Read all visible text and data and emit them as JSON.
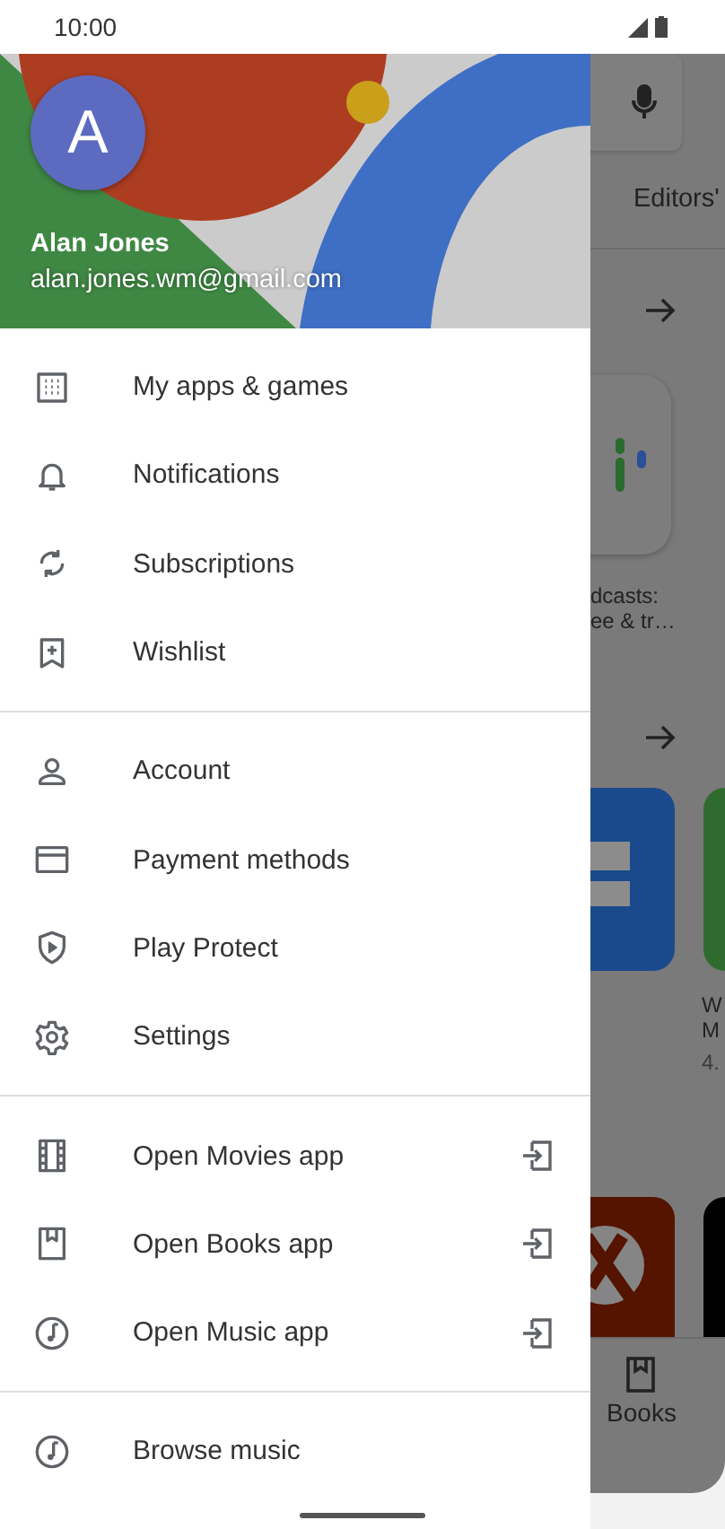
{
  "status_bar": {
    "time": "10:00"
  },
  "account": {
    "initial": "A",
    "name": "Alan Jones",
    "email": "alan.jones.wm@gmail.com"
  },
  "menu_sections": [
    {
      "items": [
        {
          "label": "My apps & games",
          "kind": "nav"
        },
        {
          "label": "Notifications",
          "kind": "nav"
        },
        {
          "label": "Subscriptions",
          "kind": "nav"
        },
        {
          "label": "Wishlist",
          "kind": "nav"
        }
      ]
    },
    {
      "items": [
        {
          "label": "Account",
          "kind": "nav"
        },
        {
          "label": "Payment methods",
          "kind": "nav"
        },
        {
          "label": "Play Protect",
          "kind": "nav"
        },
        {
          "label": "Settings",
          "kind": "nav"
        }
      ]
    },
    {
      "items": [
        {
          "label": "Open Movies app",
          "kind": "external"
        },
        {
          "label": "Open Books app",
          "kind": "external"
        },
        {
          "label": "Open Music app",
          "kind": "external"
        }
      ]
    },
    {
      "items": [
        {
          "label": "Browse music",
          "kind": "nav"
        }
      ]
    }
  ],
  "background_app": {
    "tab": "Editors'",
    "podcast_title": [
      "dcasts:",
      "ee & tr…"
    ],
    "app_title": [
      "W",
      "M"
    ],
    "rating": "4.",
    "bottom_tab": "Books"
  }
}
